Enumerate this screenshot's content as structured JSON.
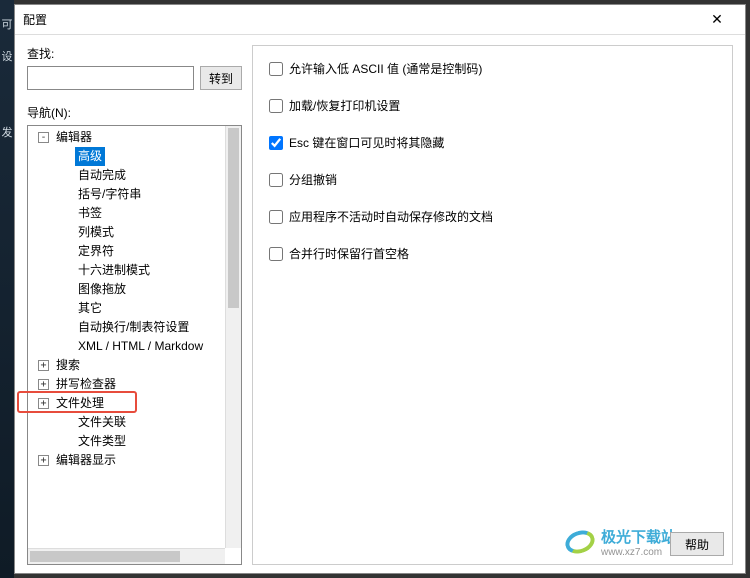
{
  "dialog": {
    "title": "配置",
    "close_tooltip": "关闭"
  },
  "left_edge": [
    "可",
    "设",
    "发"
  ],
  "search": {
    "label": "查找:",
    "value": "",
    "goto_label": "转到"
  },
  "nav": {
    "label": "导航(N):"
  },
  "tree": [
    {
      "indent": 0,
      "toggle": "-",
      "label": "编辑器",
      "name": "tree-editor"
    },
    {
      "indent": 1,
      "toggle": "",
      "label": "高级",
      "selected": true,
      "name": "tree-advanced"
    },
    {
      "indent": 1,
      "toggle": "",
      "label": "自动完成",
      "name": "tree-autocomplete"
    },
    {
      "indent": 1,
      "toggle": "",
      "label": "括号/字符串",
      "name": "tree-brackets-strings"
    },
    {
      "indent": 1,
      "toggle": "",
      "label": "书签",
      "name": "tree-bookmarks"
    },
    {
      "indent": 1,
      "toggle": "",
      "label": "列模式",
      "name": "tree-column-mode"
    },
    {
      "indent": 1,
      "toggle": "",
      "label": "定界符",
      "name": "tree-delimiters"
    },
    {
      "indent": 1,
      "toggle": "",
      "label": "十六进制模式",
      "name": "tree-hex-mode"
    },
    {
      "indent": 1,
      "toggle": "",
      "label": "图像拖放",
      "name": "tree-image-drag"
    },
    {
      "indent": 1,
      "toggle": "",
      "label": "其它",
      "name": "tree-other"
    },
    {
      "indent": 1,
      "toggle": "",
      "label": "自动换行/制表符设置",
      "name": "tree-wrap-tabs"
    },
    {
      "indent": 1,
      "toggle": "",
      "label": "XML / HTML / Markdow",
      "name": "tree-xml-html-md"
    },
    {
      "indent": 0,
      "toggle": "+",
      "label": "搜索",
      "name": "tree-search"
    },
    {
      "indent": 0,
      "toggle": "+",
      "label": "拼写检查器",
      "name": "tree-spellcheck"
    },
    {
      "indent": 0,
      "toggle": "+",
      "label": "文件处理",
      "highlighted": true,
      "name": "tree-file-handling"
    },
    {
      "indent": 1,
      "toggle": "",
      "label": "文件关联",
      "name": "tree-file-assoc"
    },
    {
      "indent": 1,
      "toggle": "",
      "label": "文件类型",
      "name": "tree-file-types"
    },
    {
      "indent": 0,
      "toggle": "+",
      "label": "编辑器显示",
      "name": "tree-editor-display"
    }
  ],
  "options": [
    {
      "checked": false,
      "label": "允许输入低 ASCII 值 (通常是控制码)",
      "name": "opt-allow-low-ascii"
    },
    {
      "checked": false,
      "label": "加载/恢复打印机设置",
      "name": "opt-load-printer"
    },
    {
      "checked": true,
      "label": "Esc 键在窗口可见时将其隐藏",
      "name": "opt-esc-hide"
    },
    {
      "checked": false,
      "label": "分组撤销",
      "name": "opt-group-undo"
    },
    {
      "checked": false,
      "label": "应用程序不活动时自动保存修改的文档",
      "name": "opt-autosave-inactive"
    },
    {
      "checked": false,
      "label": "合并行时保留行首空格",
      "name": "opt-keep-leading-space"
    }
  ],
  "footer": {
    "help_label": "帮助"
  },
  "watermark": {
    "text": "极光下载站",
    "url": "www.xz7.com"
  }
}
